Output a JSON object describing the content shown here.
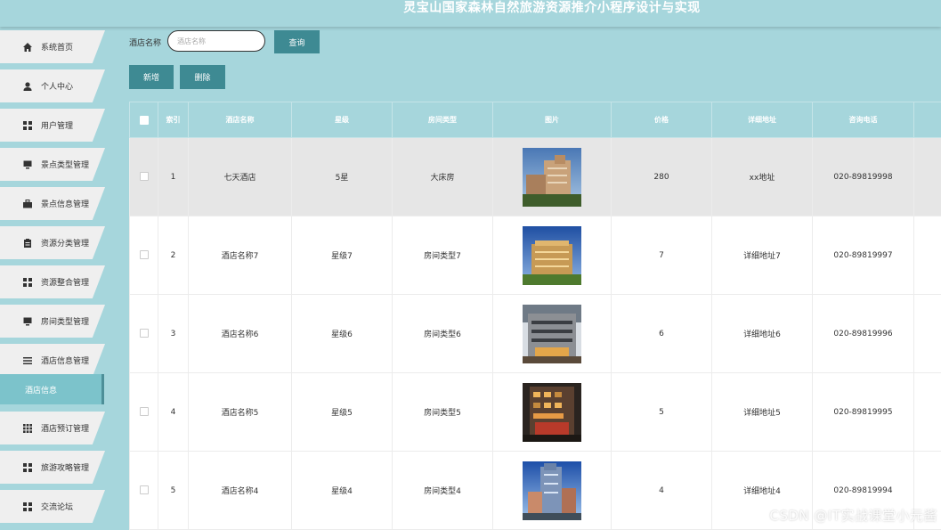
{
  "app": {
    "title": "灵宝山国家森林自然旅游资源推介小程序设计与实现"
  },
  "sidebar": {
    "items": [
      {
        "label": "系统首页",
        "icon": "home-icon"
      },
      {
        "label": "个人中心",
        "icon": "user-icon"
      },
      {
        "label": "用户管理",
        "icon": "grid-icon"
      },
      {
        "label": "景点类型管理",
        "icon": "monitor-icon"
      },
      {
        "label": "景点信息管理",
        "icon": "briefcase-icon"
      },
      {
        "label": "资源分类管理",
        "icon": "clipboard-icon"
      },
      {
        "label": "资源整合管理",
        "icon": "grid-icon"
      },
      {
        "label": "房间类型管理",
        "icon": "monitor-icon"
      },
      {
        "label": "酒店信息管理",
        "icon": "list-icon"
      },
      {
        "label": "酒店预订管理",
        "icon": "apps-icon"
      },
      {
        "label": "旅游攻略管理",
        "icon": "grid-icon"
      },
      {
        "label": "交流论坛",
        "icon": "grid-icon"
      }
    ],
    "active_sub": "酒店信息"
  },
  "search": {
    "label": "酒店名称",
    "placeholder": "酒店名称",
    "value": "",
    "button": "查询"
  },
  "actions": {
    "add": "新增",
    "delete": "删除"
  },
  "table": {
    "headers": [
      "索引",
      "酒店名称",
      "星级",
      "房间类型",
      "图片",
      "价格",
      "详细地址",
      "咨询电话"
    ],
    "rows": [
      {
        "index": "1",
        "name": "七天酒店",
        "star": "5星",
        "room_type": "大床房",
        "price": "280",
        "address": "xx地址",
        "phone": "020-89819998"
      },
      {
        "index": "2",
        "name": "酒店名称7",
        "star": "星级7",
        "room_type": "房间类型7",
        "price": "7",
        "address": "详细地址7",
        "phone": "020-89819997"
      },
      {
        "index": "3",
        "name": "酒店名称6",
        "star": "星级6",
        "room_type": "房间类型6",
        "price": "6",
        "address": "详细地址6",
        "phone": "020-89819996"
      },
      {
        "index": "4",
        "name": "酒店名称5",
        "star": "星级5",
        "room_type": "房间类型5",
        "price": "5",
        "address": "详细地址5",
        "phone": "020-89819995"
      },
      {
        "index": "5",
        "name": "酒店名称4",
        "star": "星级4",
        "room_type": "房间类型4",
        "price": "4",
        "address": "详细地址4",
        "phone": "020-89819994"
      }
    ]
  },
  "watermark": "CSDN @IT实战课堂小元酱",
  "colors": {
    "background": "#a6d6dc",
    "button": "#3e8a93",
    "active_menu": "#7cc3cb"
  }
}
